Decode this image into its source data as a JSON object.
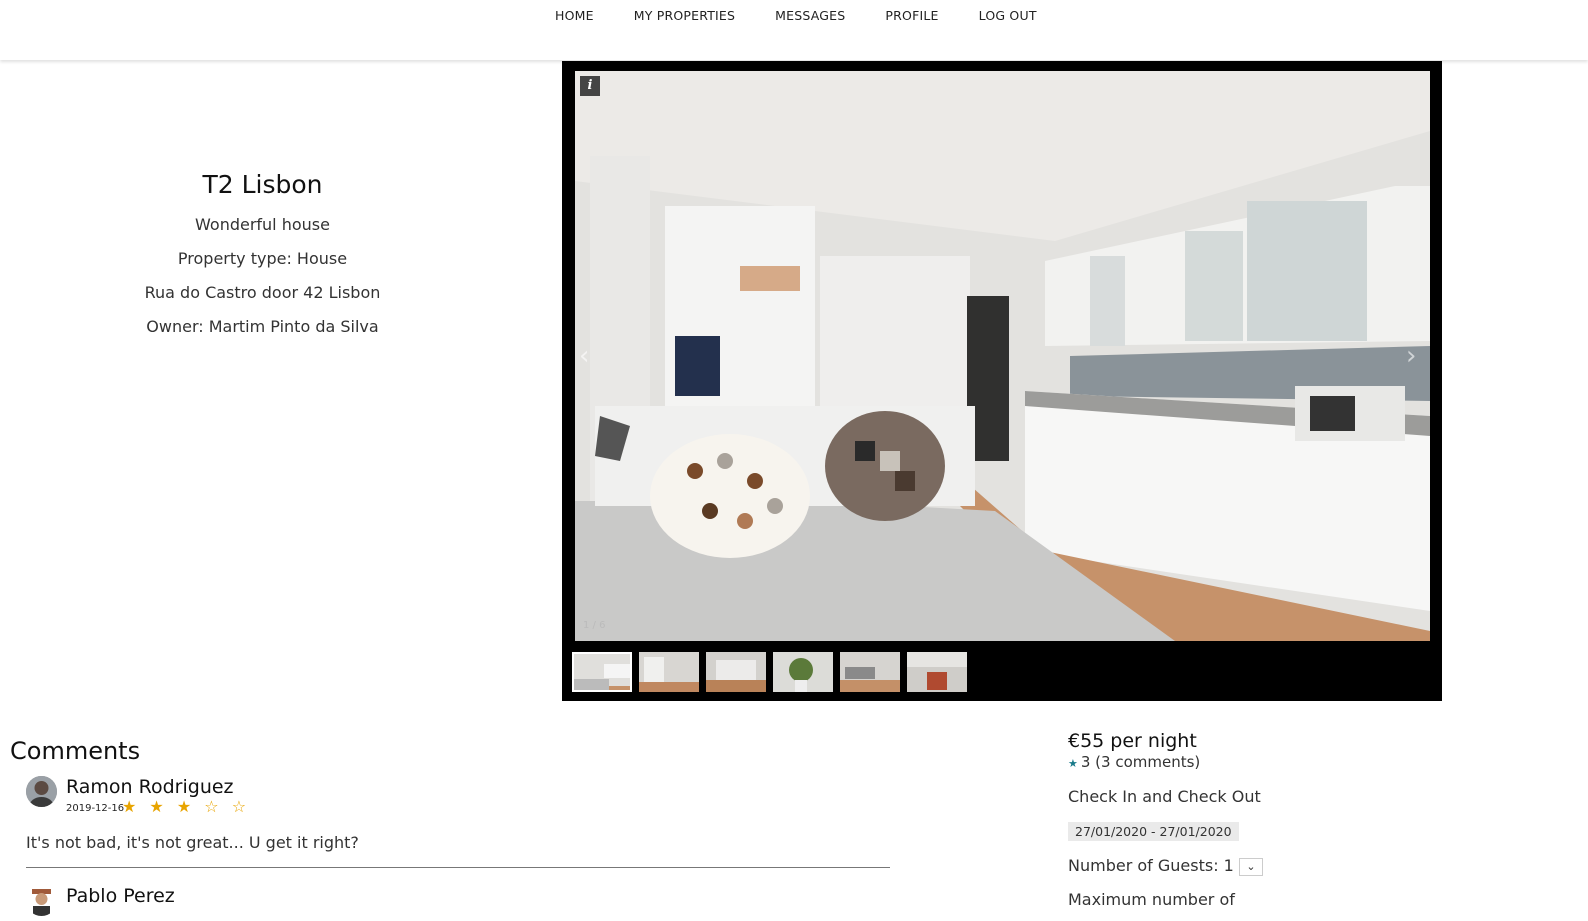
{
  "nav": {
    "items": [
      "HOME",
      "MY PROPERTIES",
      "MESSAGES",
      "PROFILE",
      "LOG OUT"
    ]
  },
  "property": {
    "title": "T2 Lisbon",
    "description": "Wonderful house",
    "type": "Property type: House",
    "address": "Rua do Castro door 42 Lisbon",
    "owner": "Owner: Martim Pinto da Silva"
  },
  "gallery": {
    "info_icon": "i",
    "counter": "1 / 6",
    "thumbnail_count": 6
  },
  "comments": {
    "title": "Comments",
    "items": [
      {
        "name": "Ramon Rodriguez",
        "date": "2019-12-16",
        "stars": "★ ★ ★ ☆ ☆",
        "rating": 3,
        "text": "It's not bad, it's not great... U get it right?"
      },
      {
        "name": "Pablo Perez",
        "date": "",
        "stars": "",
        "text": ""
      }
    ]
  },
  "booking": {
    "price": "€55 per night",
    "rating_text": "3 (3 comments)",
    "checkin_label": "Check In and Check Out",
    "dates": "27/01/2020 - 27/01/2020",
    "guests_label": "Number of Guests: 1",
    "max_label": "Maximum number of"
  },
  "colors": {
    "star": "#e8a400",
    "rating_star": "#1a7a8a"
  }
}
